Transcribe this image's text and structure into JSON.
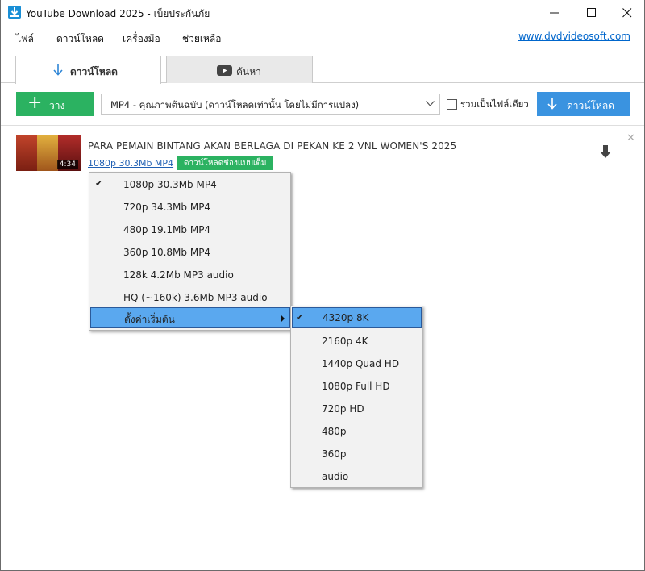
{
  "window": {
    "title": "YouTube Download 2025 - เบ็ยประกันภัย"
  },
  "menubar": {
    "items": [
      "ไฟล์",
      "ดาวน์โหลด",
      "เครื่องมือ",
      "ช่วยเหลือ"
    ],
    "site_link": "www.dvdvideosoft.com"
  },
  "tabs": [
    {
      "label": "ดาวน์โหลด",
      "icon": "download-arrow-icon",
      "active": true
    },
    {
      "label": "ค้นหา",
      "icon": "youtube-play-icon",
      "active": false
    }
  ],
  "toolbar": {
    "paste_label": "วาง",
    "format_value": "MP4 - คุณภาพต้นฉบับ (ดาวน์โหลดเท่านั้น โดยไม่มีการแปลง)",
    "merge_label": "รวมเป็นไฟล์เดียว",
    "merge_checked": false,
    "download_label": "ดาวน์โหลด"
  },
  "item": {
    "title": "PARA PEMAIN BINTANG AKAN BERLAGA DI PEKAN KE 2 VNL WOMEN'S 2025",
    "duration": "4:34",
    "quality_link": "1080p 30.3Mb MP4",
    "original_badge": "ดาวน์โหลดช่องแบบเต็ม"
  },
  "quality_menu": {
    "items": [
      {
        "label": "1080p 30.3Mb MP4",
        "checked": true
      },
      {
        "label": "720p 34.3Mb MP4",
        "checked": false
      },
      {
        "label": "480p 19.1Mb MP4",
        "checked": false
      },
      {
        "label": "360p 10.8Mb MP4",
        "checked": false
      },
      {
        "label": "128k 4.2Mb MP3 audio",
        "checked": false
      },
      {
        "label": "HQ (~160k) 3.6Mb MP3 audio",
        "checked": false
      },
      {
        "label": "ตั้งค่าเริ่มต้น",
        "checked": false,
        "submenu": true,
        "highlighted": true
      }
    ]
  },
  "preset_menu": {
    "items": [
      {
        "label": "4320p 8K",
        "checked": true,
        "highlighted": true
      },
      {
        "label": "2160p 4K",
        "checked": false
      },
      {
        "label": "1440p Quad HD",
        "checked": false
      },
      {
        "label": "1080p Full HD",
        "checked": false
      },
      {
        "label": "720p HD",
        "checked": false
      },
      {
        "label": "480p",
        "checked": false
      },
      {
        "label": "360p",
        "checked": false
      },
      {
        "label": "audio",
        "checked": false
      }
    ]
  },
  "colors": {
    "paste_button": "#2bb261",
    "download_button": "#3a93e0",
    "menu_highlight": "#5aa8ef",
    "link": "#0066cc"
  }
}
